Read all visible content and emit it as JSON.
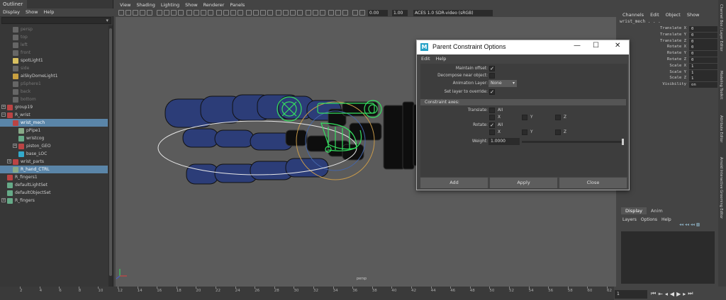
{
  "outliner": {
    "tab": "Outliner",
    "menu": [
      "Display",
      "Show",
      "Help"
    ],
    "items": [
      {
        "label": "persp",
        "dim": true
      },
      {
        "label": "top",
        "dim": true
      },
      {
        "label": "left",
        "dim": true
      },
      {
        "label": "front",
        "dim": true
      },
      {
        "label": "spotLight1",
        "dim": false
      },
      {
        "label": "side",
        "dim": true
      },
      {
        "label": "aiSkyDomeLight1",
        "dim": false
      },
      {
        "label": "pSphere1",
        "dim": true
      },
      {
        "label": "back",
        "dim": true
      },
      {
        "label": "bottom",
        "dim": true
      },
      {
        "label": "group19",
        "dim": false
      },
      {
        "label": "R_wrist",
        "dim": false
      },
      {
        "label": "wrist_mech",
        "dim": false
      },
      {
        "label": "pPipe1",
        "dim": false
      },
      {
        "label": "wristcog",
        "dim": false
      },
      {
        "label": "piston_GEO",
        "dim": false
      },
      {
        "label": "base_LOC",
        "dim": false
      },
      {
        "label": "wrist_parts",
        "dim": false
      },
      {
        "label": "R_hand_CTRL",
        "dim": false
      },
      {
        "label": "R_fingers1",
        "dim": false
      },
      {
        "label": "defaultLightSet",
        "dim": false
      },
      {
        "label": "defaultObjectSet",
        "dim": false
      },
      {
        "label": "R_fingers",
        "dim": false
      }
    ]
  },
  "viewport": {
    "menu": [
      "View",
      "Shading",
      "Lighting",
      "Show",
      "Renderer",
      "Panels"
    ],
    "exposure": "0.00",
    "gamma": "1.00",
    "color_space": "ACES 1.0 SDR-video (sRGB)",
    "camera_label": "persp",
    "colors": {
      "bg": "#5b5b5b",
      "mesh": "#2c3d78",
      "black": "#0e0e0e",
      "select": "#35e060"
    }
  },
  "channel_box": {
    "menu": [
      "Channels",
      "Edit",
      "Object",
      "Show"
    ],
    "object": "wrist_mech . . .",
    "attrs": [
      {
        "name": "Translate X",
        "value": "0"
      },
      {
        "name": "Translate Y",
        "value": "0"
      },
      {
        "name": "Translate Z",
        "value": "0"
      },
      {
        "name": "Rotate X",
        "value": "0"
      },
      {
        "name": "Rotate Y",
        "value": "0"
      },
      {
        "name": "Rotate Z",
        "value": "0"
      },
      {
        "name": "Scale X",
        "value": "1"
      },
      {
        "name": "Scale Y",
        "value": "1"
      },
      {
        "name": "Scale Z",
        "value": "1"
      },
      {
        "name": "Visibility",
        "value": "on"
      }
    ],
    "side_tabs": [
      "Channel Box / Layer Editor",
      "Modeling Toolkit",
      "Attribute Editor",
      "Arnold Interactive Grooming Editor"
    ]
  },
  "layers": {
    "tabs": [
      "Display",
      "Anim"
    ],
    "menu": [
      "Layers",
      "Options",
      "Help"
    ]
  },
  "timeline": {
    "ticks": [
      "2",
      "4",
      "6",
      "8",
      "10",
      "12",
      "14",
      "16",
      "18",
      "20",
      "22",
      "24",
      "26",
      "28",
      "30",
      "32",
      "34",
      "36",
      "38",
      "40",
      "42",
      "44",
      "46",
      "48",
      "50",
      "52",
      "54",
      "56",
      "58",
      "60",
      "62"
    ],
    "current_frame": "1"
  },
  "dialog": {
    "title": "Parent Constraint Options",
    "menu": [
      "Edit",
      "Help"
    ],
    "maintain_offset_label": "Maintain offset:",
    "maintain_offset_check": "✓",
    "decompose_label": "Decompose near object:",
    "anim_layer_label": "Animation Layer:",
    "anim_layer_value": "None",
    "set_layer_label": "Set layer to override:",
    "set_layer_check": "✓",
    "section": "Constraint axes:",
    "translate_label": "Translate:",
    "rotate_label": "Rotate:",
    "all": "All",
    "x": "X",
    "y": "Y",
    "z": "Z",
    "rotate_all_check": "✓",
    "weight_label": "Weight:",
    "weight_value": "1.0000",
    "buttons": {
      "add": "Add",
      "apply": "Apply",
      "close": "Close"
    }
  }
}
